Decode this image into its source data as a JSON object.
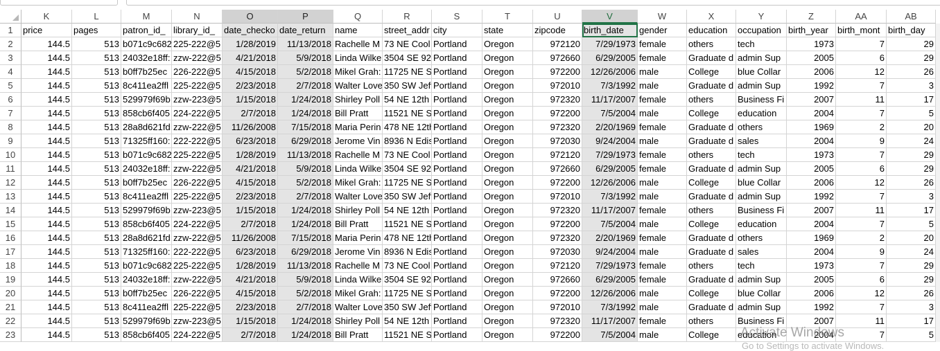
{
  "watermark": {
    "title": "Activate Windows",
    "subtitle": "Go to Settings to activate Windows."
  },
  "columns": [
    {
      "letter": "K",
      "name": "price"
    },
    {
      "letter": "L",
      "name": "pages"
    },
    {
      "letter": "M",
      "name": "patron_id_"
    },
    {
      "letter": "N",
      "name": "library_id_"
    },
    {
      "letter": "O",
      "name": "date_checko"
    },
    {
      "letter": "P",
      "name": "date_return"
    },
    {
      "letter": "Q",
      "name": "name"
    },
    {
      "letter": "R",
      "name": "street_addr"
    },
    {
      "letter": "S",
      "name": "city"
    },
    {
      "letter": "T",
      "name": "state"
    },
    {
      "letter": "U",
      "name": "zipcode"
    },
    {
      "letter": "V",
      "name": "birth_date"
    },
    {
      "letter": "W",
      "name": "gender"
    },
    {
      "letter": "X",
      "name": "education"
    },
    {
      "letter": "Y",
      "name": "occupation"
    },
    {
      "letter": "Z",
      "name": "birth_year"
    },
    {
      "letter": "AA",
      "name": "birth_mont"
    },
    {
      "letter": "AB",
      "name": "birth_day"
    }
  ],
  "rows": [
    {
      "num": "2",
      "cells": [
        "144.5",
        "513",
        "b071c9c682",
        "225-222@5",
        "1/28/2019",
        "11/13/2018",
        "Rachelle M",
        "73  NE Cool",
        "Portland",
        "Oregon",
        "972120",
        "7/29/1973",
        "female",
        "others",
        "tech",
        "1973",
        "7",
        "29"
      ]
    },
    {
      "num": "3",
      "cells": [
        "144.5",
        "513",
        "24032e18ff:",
        "zzw-222@5",
        "4/21/2018",
        "5/9/2018",
        "Linda Wilke",
        "3504 SE 92n",
        "Portland",
        "Oregon",
        "972660",
        "6/29/2005",
        "female",
        "Graduate d",
        "admin  Sup",
        "2005",
        "6",
        "29"
      ]
    },
    {
      "num": "4",
      "cells": [
        "144.5",
        "513",
        "b0ff7b25ec",
        "226-222@5",
        "4/15/2018",
        "5/2/2018",
        "Mikel Grah:",
        "11725 NE Sa",
        "Portland",
        "Oregon",
        "972200",
        "12/26/2006",
        "male",
        "College",
        "blue Collar",
        "2006",
        "12",
        "26"
      ]
    },
    {
      "num": "5",
      "cells": [
        "144.5",
        "513",
        "8c411ea2ffl",
        "225-222@5",
        "2/23/2018",
        "2/7/2018",
        "Walter Love",
        "350 SW Jeff",
        "Portland",
        "Oregon",
        "972010",
        "7/3/1992",
        "male",
        "Graduate d",
        "admin  Sup",
        "1992",
        "7",
        "3"
      ]
    },
    {
      "num": "6",
      "cells": [
        "144.5",
        "513",
        "529979f69b",
        "zzw-223@5",
        "1/15/2018",
        "1/24/2018",
        "Shirley Poll",
        "54 NE 12th ,",
        "Portland",
        "Oregon",
        "972320",
        "11/17/2007",
        "female",
        "others",
        "Business  Fi",
        "2007",
        "11",
        "17"
      ]
    },
    {
      "num": "7",
      "cells": [
        "144.5",
        "513",
        "858cb6f405",
        "224-222@5",
        "2/7/2018",
        "1/24/2018",
        "Bill Pratt",
        "11521 NE Sa",
        "Portland",
        "Oregon",
        "972200",
        "7/5/2004",
        "male",
        "College",
        "education",
        "2004",
        "7",
        "5"
      ]
    },
    {
      "num": "8",
      "cells": [
        "144.5",
        "513",
        "28a8d621fd",
        "zzw-222@5",
        "11/26/2008",
        "7/15/2018",
        "Maria Perin",
        "478 NE 12th",
        "Portland",
        "Oregon",
        "972320",
        "2/20/1969",
        "female",
        "Graduate d",
        "others",
        "1969",
        "2",
        "20"
      ]
    },
    {
      "num": "9",
      "cells": [
        "144.5",
        "513",
        "71325ff160:",
        "222-222@5",
        "6/23/2018",
        "6/29/2018",
        "Jerome Vin",
        "8936 N Edis",
        "Portland",
        "Oregon",
        "972030",
        "9/24/2004",
        "male",
        "Graduate d",
        "sales",
        "2004",
        "9",
        "24"
      ]
    },
    {
      "num": "10",
      "cells": [
        "144.5",
        "513",
        "b071c9c682",
        "225-222@5",
        "1/28/2019",
        "11/13/2018",
        "Rachelle M",
        "73  NE Cool",
        "Portland",
        "Oregon",
        "972120",
        "7/29/1973",
        "female",
        "others",
        "tech",
        "1973",
        "7",
        "29"
      ]
    },
    {
      "num": "11",
      "cells": [
        "144.5",
        "513",
        "24032e18ff:",
        "zzw-222@5",
        "4/21/2018",
        "5/9/2018",
        "Linda Wilke",
        "3504 SE 92n",
        "Portland",
        "Oregon",
        "972660",
        "6/29/2005",
        "female",
        "Graduate d",
        "admin  Sup",
        "2005",
        "6",
        "29"
      ]
    },
    {
      "num": "12",
      "cells": [
        "144.5",
        "513",
        "b0ff7b25ec",
        "226-222@5",
        "4/15/2018",
        "5/2/2018",
        "Mikel Grah:",
        "11725 NE Sa",
        "Portland",
        "Oregon",
        "972200",
        "12/26/2006",
        "male",
        "College",
        "blue Collar",
        "2006",
        "12",
        "26"
      ]
    },
    {
      "num": "13",
      "cells": [
        "144.5",
        "513",
        "8c411ea2ffl",
        "225-222@5",
        "2/23/2018",
        "2/7/2018",
        "Walter Love",
        "350 SW Jeff",
        "Portland",
        "Oregon",
        "972010",
        "7/3/1992",
        "male",
        "Graduate d",
        "admin  Sup",
        "1992",
        "7",
        "3"
      ]
    },
    {
      "num": "14",
      "cells": [
        "144.5",
        "513",
        "529979f69b",
        "zzw-223@5",
        "1/15/2018",
        "1/24/2018",
        "Shirley Poll",
        "54 NE 12th ,",
        "Portland",
        "Oregon",
        "972320",
        "11/17/2007",
        "female",
        "others",
        "Business  Fi",
        "2007",
        "11",
        "17"
      ]
    },
    {
      "num": "15",
      "cells": [
        "144.5",
        "513",
        "858cb6f405",
        "224-222@5",
        "2/7/2018",
        "1/24/2018",
        "Bill Pratt",
        "11521 NE Sa",
        "Portland",
        "Oregon",
        "972200",
        "7/5/2004",
        "male",
        "College",
        "education",
        "2004",
        "7",
        "5"
      ]
    },
    {
      "num": "16",
      "cells": [
        "144.5",
        "513",
        "28a8d621fd",
        "zzw-222@5",
        "11/26/2008",
        "7/15/2018",
        "Maria Perin",
        "478 NE 12th",
        "Portland",
        "Oregon",
        "972320",
        "2/20/1969",
        "female",
        "Graduate d",
        "others",
        "1969",
        "2",
        "20"
      ]
    },
    {
      "num": "17",
      "cells": [
        "144.5",
        "513",
        "71325ff160:",
        "222-222@5",
        "6/23/2018",
        "6/29/2018",
        "Jerome Vin",
        "8936 N Edis",
        "Portland",
        "Oregon",
        "972030",
        "9/24/2004",
        "male",
        "Graduate d",
        "sales",
        "2004",
        "9",
        "24"
      ]
    },
    {
      "num": "18",
      "cells": [
        "144.5",
        "513",
        "b071c9c682",
        "225-222@5",
        "1/28/2019",
        "11/13/2018",
        "Rachelle M",
        "73  NE Cool",
        "Portland",
        "Oregon",
        "972120",
        "7/29/1973",
        "female",
        "others",
        "tech",
        "1973",
        "7",
        "29"
      ]
    },
    {
      "num": "19",
      "cells": [
        "144.5",
        "513",
        "24032e18ff:",
        "zzw-222@5",
        "4/21/2018",
        "5/9/2018",
        "Linda Wilke",
        "3504 SE 92n",
        "Portland",
        "Oregon",
        "972660",
        "6/29/2005",
        "female",
        "Graduate d",
        "admin  Sup",
        "2005",
        "6",
        "29"
      ]
    },
    {
      "num": "20",
      "cells": [
        "144.5",
        "513",
        "b0ff7b25ec",
        "226-222@5",
        "4/15/2018",
        "5/2/2018",
        "Mikel Grah:",
        "11725 NE Sa",
        "Portland",
        "Oregon",
        "972200",
        "12/26/2006",
        "male",
        "College",
        "blue Collar",
        "2006",
        "12",
        "26"
      ]
    },
    {
      "num": "21",
      "cells": [
        "144.5",
        "513",
        "8c411ea2ffl",
        "225-222@5",
        "2/23/2018",
        "2/7/2018",
        "Walter Love",
        "350 SW Jeff",
        "Portland",
        "Oregon",
        "972010",
        "7/3/1992",
        "male",
        "Graduate d",
        "admin  Sup",
        "1992",
        "7",
        "3"
      ]
    },
    {
      "num": "22",
      "cells": [
        "144.5",
        "513",
        "529979f69b",
        "zzw-223@5",
        "1/15/2018",
        "1/24/2018",
        "Shirley Poll",
        "54 NE 12th ,",
        "Portland",
        "Oregon",
        "972320",
        "11/17/2007",
        "female",
        "others",
        "Business  Fi",
        "2007",
        "11",
        "17"
      ]
    },
    {
      "num": "23",
      "cells": [
        "144.5",
        "513",
        "858cb6f405",
        "224-222@5",
        "2/7/2018",
        "1/24/2018",
        "Bill Pratt",
        "11521 NE Sa",
        "Portland",
        "Oregon",
        "972200",
        "7/5/2004",
        "male",
        "College",
        "education",
        "2004",
        "7",
        "5"
      ]
    }
  ]
}
